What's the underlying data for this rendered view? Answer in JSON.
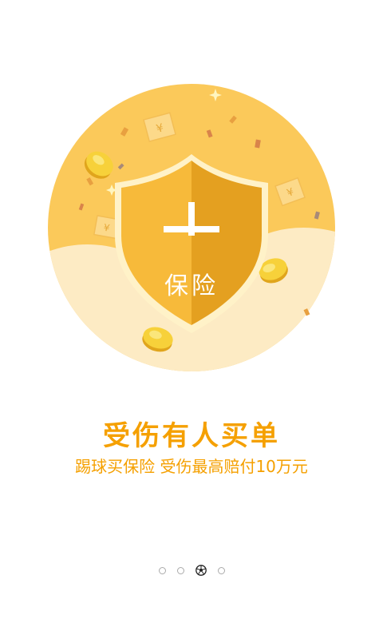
{
  "illustration": {
    "shield_cross_icon": "plus-icon",
    "shield_label": "保险",
    "colors": {
      "circle": "#FBC95A",
      "cloud": "#FDEBC4",
      "shield_left": "#F7BA3A",
      "shield_right": "#E4A020",
      "coin": "#F3C72A",
      "accent_text": "#F5A000"
    }
  },
  "headline": "受伤有人买单",
  "subline": "踢球买保险 受伤最高赔付10万元",
  "pager": {
    "total_pages": 4,
    "active_page": 3,
    "active_icon": "soccer-ball-icon"
  }
}
